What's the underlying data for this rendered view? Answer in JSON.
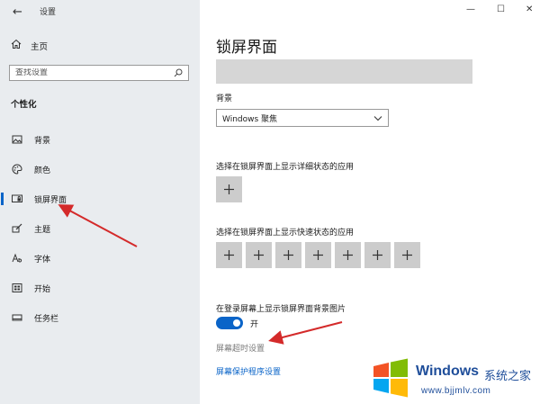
{
  "window": {
    "title": "设置",
    "controls": [
      "—",
      "☐",
      "✕"
    ]
  },
  "sidebar": {
    "home_label": "主页",
    "search_placeholder": "查找设置",
    "section_heading": "个性化",
    "items": [
      {
        "label": "背景",
        "icon": "image-icon"
      },
      {
        "label": "颜色",
        "icon": "palette-icon"
      },
      {
        "label": "锁屏界面",
        "icon": "lock-screen-icon",
        "active": true
      },
      {
        "label": "主题",
        "icon": "brush-icon"
      },
      {
        "label": "字体",
        "icon": "font-icon"
      },
      {
        "label": "开始",
        "icon": "start-icon"
      },
      {
        "label": "任务栏",
        "icon": "taskbar-icon"
      }
    ]
  },
  "main": {
    "page_title": "锁屏界面",
    "background_label": "背景",
    "background_value": "Windows 聚焦",
    "detailed_status_label": "选择在锁屏界面上显示详细状态的应用",
    "quick_status_label": "选择在锁屏界面上显示快速状态的应用",
    "quick_status_slots": 7,
    "show_bg_label": "在登录屏幕上显示锁屏界面背景图片",
    "toggle_state": "开",
    "toggle_on": true,
    "timeout_link": "屏幕超时设置",
    "screensaver_link": "屏幕保护程序设置"
  },
  "watermark": {
    "brand": "Windows",
    "subtitle": "系统之家",
    "url": "www.bjjmlv.com"
  },
  "colors": {
    "accent": "#0a64c8",
    "sidebar_bg": "#e9ecef",
    "annotation_arrow": "#d42a2a"
  }
}
